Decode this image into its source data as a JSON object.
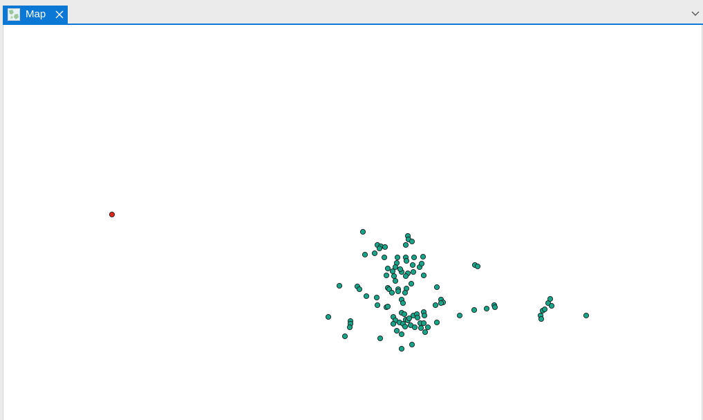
{
  "tab": {
    "label": "Map",
    "icon": "map-icon",
    "active_color": "#0a78d4",
    "label_color": "#ffffff"
  },
  "tabstrip": {
    "overflow_icon": "chevron-down-icon"
  },
  "map": {
    "background": "#ffffff",
    "point_color": "#17a589",
    "point_stroke": "#1a1a1a",
    "highlight_color": "#e0261a"
  }
}
